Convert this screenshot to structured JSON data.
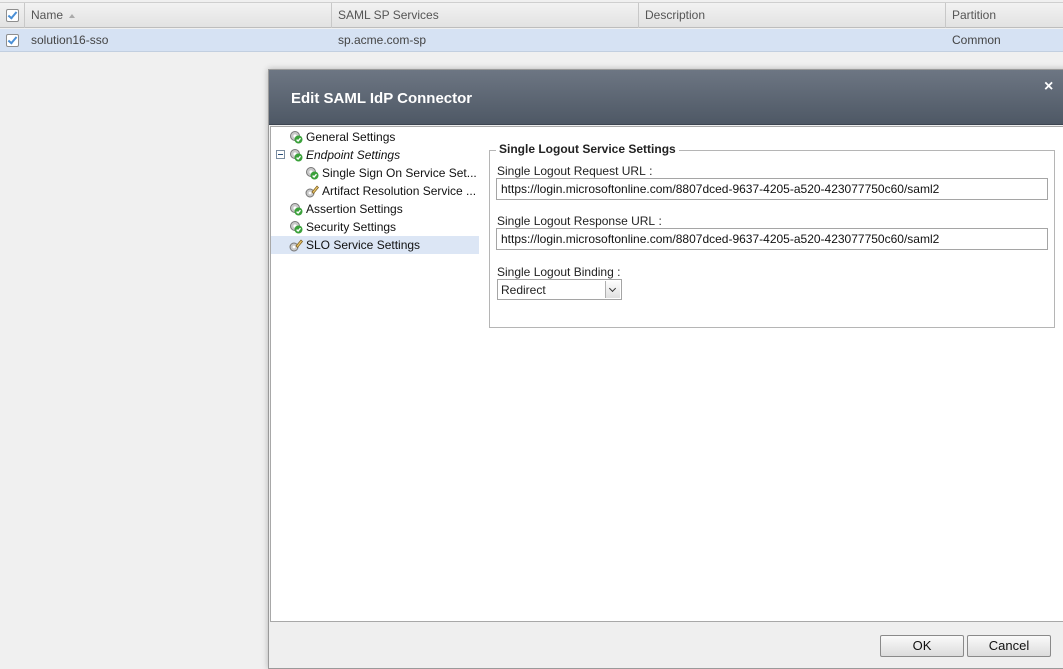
{
  "table": {
    "columns": [
      "Name",
      "SAML SP Services",
      "Description",
      "Partition"
    ],
    "rows": [
      {
        "name": "solution16-sso",
        "sp_services": "sp.acme.com-sp",
        "description": "",
        "partition": "Common"
      }
    ]
  },
  "dialog": {
    "title": "Edit SAML IdP Connector",
    "close_icon": "×",
    "tree": [
      {
        "label": "General Settings",
        "icon": "check-gear-icon"
      },
      {
        "label": "Endpoint Settings",
        "icon": "check-gear-icon",
        "expanded": true
      },
      {
        "label": "Single Sign On Service Set...",
        "icon": "check-gear-icon"
      },
      {
        "label": "Artifact Resolution Service ...",
        "icon": "pencil-gear-icon"
      },
      {
        "label": "Assertion Settings",
        "icon": "check-gear-icon"
      },
      {
        "label": "Security Settings",
        "icon": "check-gear-icon"
      },
      {
        "label": "SLO Service Settings",
        "icon": "pencil-gear-icon",
        "selected": true
      }
    ],
    "panel": {
      "legend": "Single Logout Service Settings",
      "request_url_label": "Single Logout Request URL :",
      "request_url_value": "https://login.microsoftonline.com/8807dced-9637-4205-a520-423077750c60/saml2",
      "response_url_label": "Single Logout Response URL :",
      "response_url_value": "https://login.microsoftonline.com/8807dced-9637-4205-a520-423077750c60/saml2",
      "binding_label": "Single Logout Binding :",
      "binding_value": "Redirect"
    },
    "buttons": {
      "ok": "OK",
      "cancel": "Cancel"
    }
  },
  "colors": {
    "title_bar": "#56606d",
    "row_selected": "#d6e2f3",
    "tree_selected": "#dce6f5",
    "check_green": "#3aa13a"
  }
}
